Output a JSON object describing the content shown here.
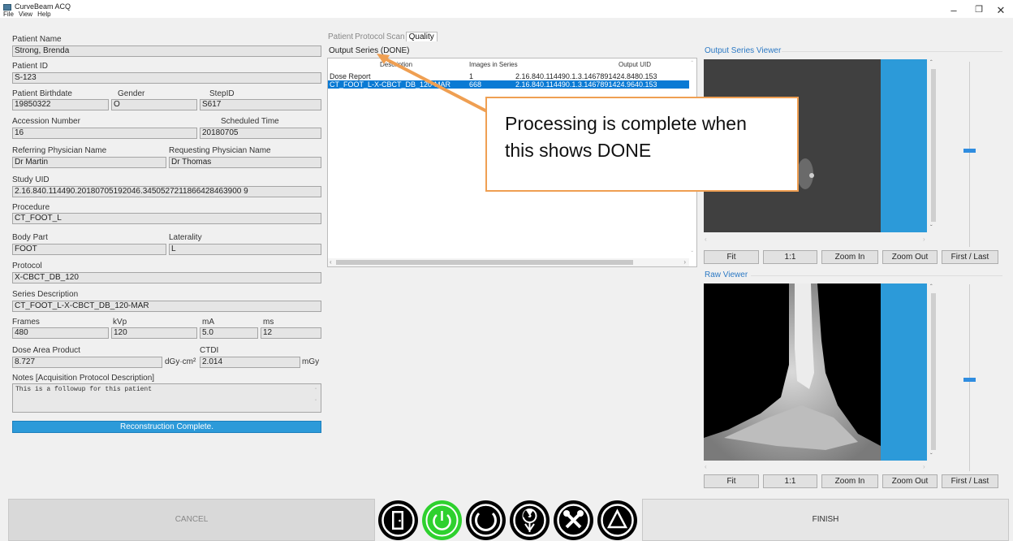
{
  "app": {
    "title": "CurveBeam ACQ",
    "menu": [
      "File",
      "View",
      "Help"
    ],
    "window_controls": [
      "minimize-icon",
      "maximize-icon",
      "close-icon"
    ]
  },
  "patient": {
    "name_label": "Patient Name",
    "name": "Strong, Brenda",
    "id_label": "Patient ID",
    "id": "S-123",
    "birthdate_label": "Patient Birthdate",
    "birthdate": "19850322",
    "gender_label": "Gender",
    "gender": "O",
    "stepid_label": "StepID",
    "stepid": "S617",
    "accession_label": "Accession Number",
    "accession": "16",
    "scheduled_label": "Scheduled Time",
    "scheduled": "20180705",
    "referring_label": "Referring Physician Name",
    "referring": "Dr Martin",
    "requesting_label": "Requesting Physician Name",
    "requesting": "Dr Thomas",
    "study_uid_label": "Study UID",
    "study_uid": "2.16.840.114490.20180705192046.3450527211866428463900 9",
    "procedure_label": "Procedure",
    "procedure": "CT_FOOT_L",
    "body_part_label": "Body Part",
    "body_part": "FOOT",
    "laterality_label": "Laterality",
    "laterality": "L",
    "protocol_label": "Protocol",
    "protocol": "X-CBCT_DB_120",
    "series_desc_label": "Series Description",
    "series_desc": "CT_FOOT_L-X-CBCT_DB_120-MAR",
    "frames_label": "Frames",
    "frames": "480",
    "kvp_label": "kVp",
    "kvp": "120",
    "ma_label": "mA",
    "ma": "5.0",
    "ms_label": "ms",
    "ms": "12",
    "dap_label": "Dose Area Product",
    "dap": "8.727",
    "dap_unit": "dGy·cm²",
    "ctdi_label": "CTDI",
    "ctdi": "2.014",
    "ctdi_unit": "mGy",
    "notes_label": "Notes [Acquisition Protocol Description]",
    "notes": "This is a followup for this patient",
    "status": "Reconstruction Complete."
  },
  "tabs": [
    "Patient",
    "Protocol",
    "Scan",
    "Quality"
  ],
  "active_tab": "Quality",
  "output_series": {
    "label": "Output Series (DONE)",
    "columns": [
      "Description",
      "Images in Series",
      "Output UID"
    ],
    "rows": [
      {
        "description": "Dose Report",
        "images": "1",
        "uid": "2.16.840.114490.1.3.1467891424.8480.153"
      },
      {
        "description": "CT_FOOT_L-X-CBCT_DB_120-MAR",
        "images": "668",
        "uid": "2.16.840.114490.1.3.1467891424.9640.153"
      }
    ],
    "selected_row": 1
  },
  "callout": {
    "text": "Processing is complete when this shows DONE"
  },
  "viewers": {
    "output_title": "Output Series Viewer",
    "raw_title": "Raw Viewer",
    "buttons": [
      "Fit",
      "1:1",
      "Zoom In",
      "Zoom Out",
      "First / Last"
    ]
  },
  "footer": {
    "cancel": "CANCEL",
    "finish": "FINISH",
    "icons": [
      "door-exit-icon",
      "power-icon",
      "refresh-ring-icon",
      "radiation-tower-icon",
      "tools-icon",
      "warning-triangle-icon"
    ]
  },
  "colors": {
    "accent_blue": "#2c9ad9",
    "selection_blue": "#0a7ad4",
    "callout_border": "#ef9f52",
    "power_green": "#33cc33"
  }
}
